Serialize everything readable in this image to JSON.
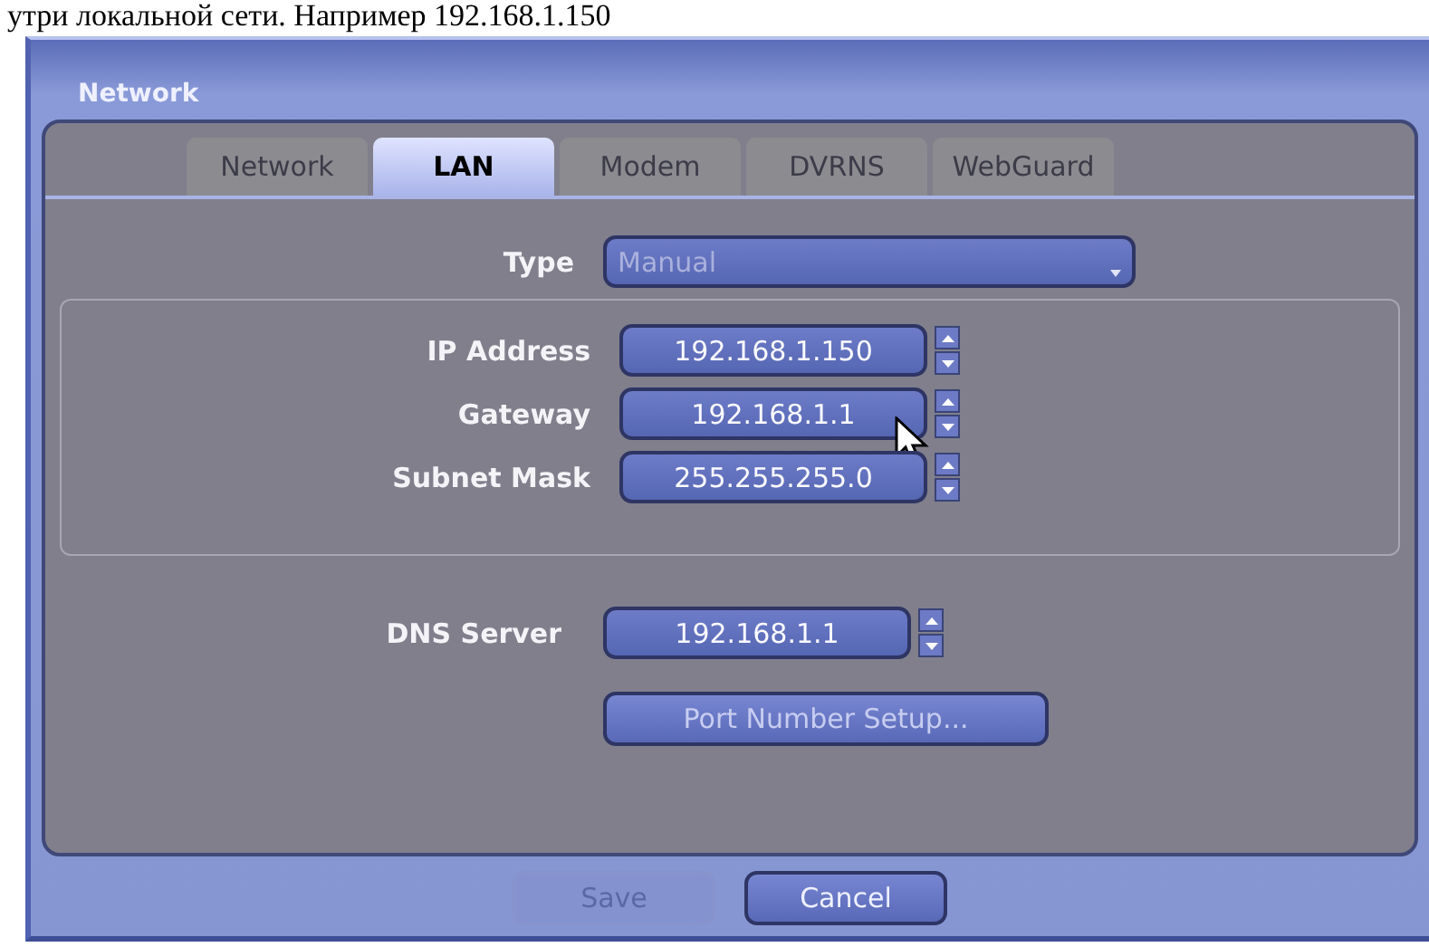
{
  "caption": "утри локальной сети. Например 192.168.1.150",
  "window": {
    "title": "Network"
  },
  "tabs": [
    {
      "label": "Network",
      "selected": false
    },
    {
      "label": "LAN",
      "selected": true
    },
    {
      "label": "Modem",
      "selected": false
    },
    {
      "label": "DVRNS",
      "selected": false
    },
    {
      "label": "WebGuard",
      "selected": false
    }
  ],
  "type_field": {
    "label": "Type",
    "value": "Manual",
    "disabled": true
  },
  "address_fields": [
    {
      "label": "IP Address",
      "value": "192.168.1.150"
    },
    {
      "label": "Gateway",
      "value": "192.168.1.1"
    },
    {
      "label": "Subnet Mask",
      "value": "255.255.255.0"
    }
  ],
  "dns_field": {
    "label": "DNS Server",
    "value": "192.168.1.1"
  },
  "port_button": {
    "label": "Port Number Setup..."
  },
  "buttons": [
    {
      "label": "Save",
      "disabled": true
    },
    {
      "label": "Cancel",
      "disabled": false
    }
  ]
}
